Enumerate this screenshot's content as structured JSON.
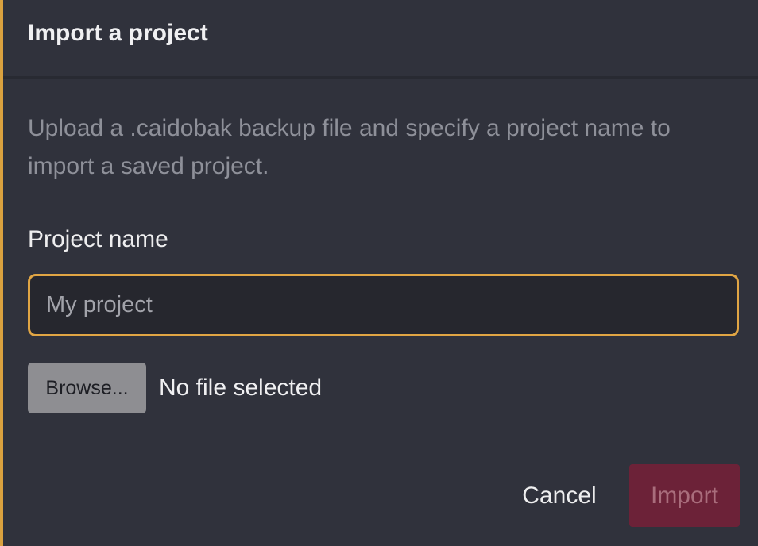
{
  "dialog": {
    "title": "Import a project",
    "description": "Upload a .caidobak backup file and specify a project name to import a saved project."
  },
  "form": {
    "project_name_label": "Project name",
    "project_name_value": "",
    "project_name_placeholder": "My project",
    "browse_label": "Browse...",
    "file_status": "No file selected"
  },
  "actions": {
    "cancel_label": "Cancel",
    "import_label": "Import",
    "import_disabled": true
  },
  "colors": {
    "accent": "#d9a13f",
    "background": "#30323c",
    "import_button": "#6c2238"
  }
}
